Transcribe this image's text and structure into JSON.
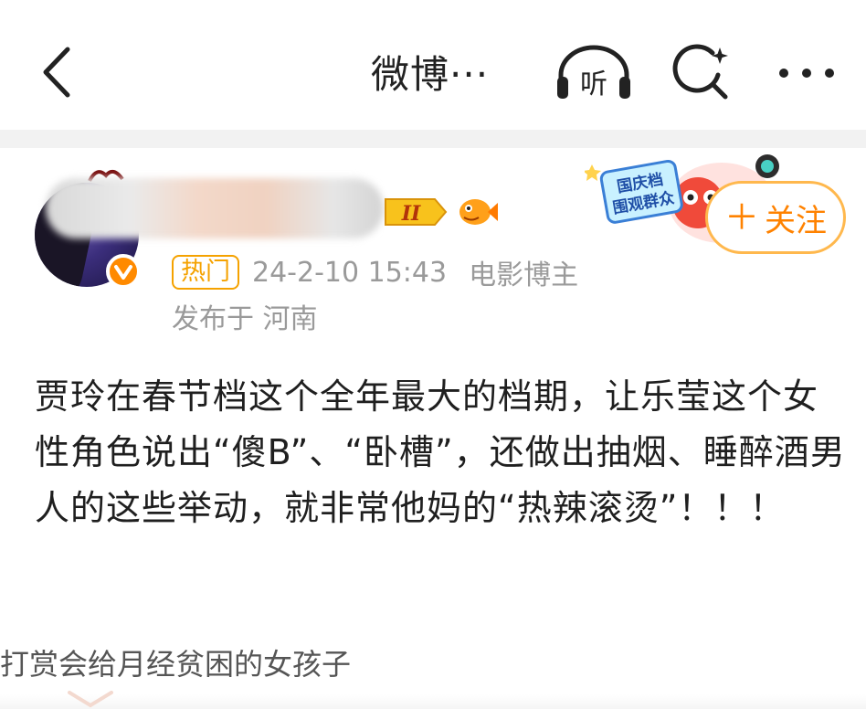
{
  "nav": {
    "title": "微博···",
    "listen_label": "听",
    "icons": [
      "back-arrow-icon",
      "listen-icon",
      "search-icon",
      "more-icon"
    ]
  },
  "post": {
    "hot_tag": "热门",
    "timestamp": "24-2-10 15:43",
    "author_role": "电影博主",
    "location": "发布于 河南",
    "level_badge": "II",
    "sticker_text": "国庆档围观群众",
    "follow_label": "关注",
    "content": "贾玲在春节档这个全年最大的档期，让乐莹这个女性角色说出“傻B”、“卧槽”，还做出抽烟、睡醉酒男人的这些举动，就非常他妈的“热辣滚烫”！！！"
  },
  "reward": {
    "text": "打赏会给月经贫困的女孩子"
  },
  "colors": {
    "accent": "#ff8200",
    "hot_tag": "#f5a200",
    "meta": "#9a9a9a",
    "follow_border": "#ffb84d"
  }
}
